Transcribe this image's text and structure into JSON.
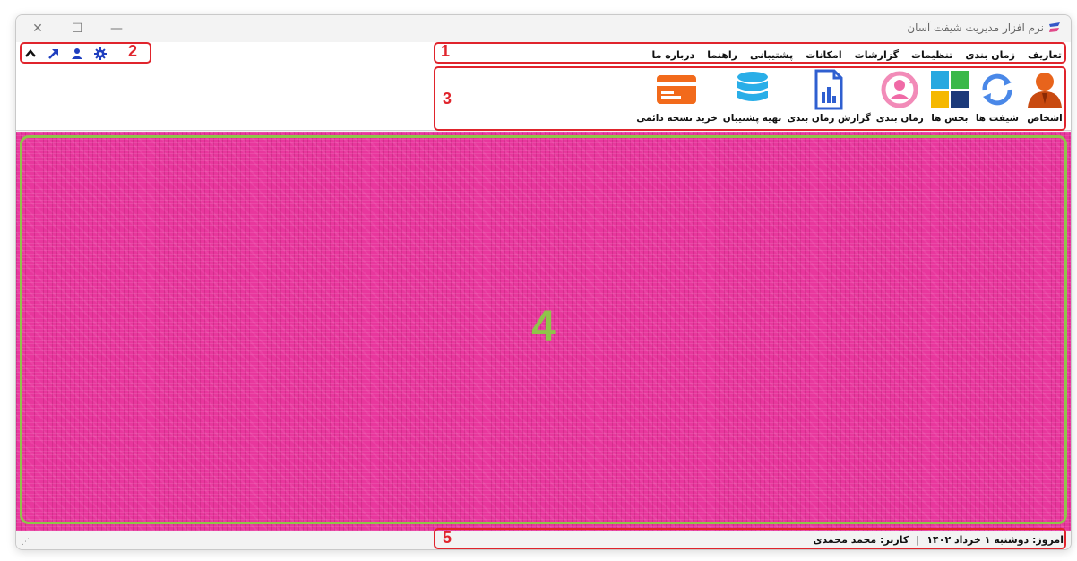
{
  "window": {
    "title": "نرم افزار مدیریت شیفت آسان",
    "controls": {
      "close": "✕",
      "maximize": "☐",
      "minimize": "—"
    }
  },
  "menu": {
    "items": [
      "تعاریف",
      "زمان بندی",
      "تنظیمات",
      "گزارشات",
      "امکانات",
      "پشتیبانی",
      "راهنما",
      "درباره ما"
    ]
  },
  "quick_icons": [
    "gear-icon",
    "user-icon",
    "arrow-up-right-icon",
    "chevron-up-icon"
  ],
  "ribbon": {
    "items": [
      {
        "label": "اشخاص",
        "icon": "person-icon"
      },
      {
        "label": "شیفت ها",
        "icon": "refresh-cycle-icon"
      },
      {
        "label": "بخش ها",
        "icon": "tiles-icon"
      },
      {
        "label": "زمان بندی",
        "icon": "schedule-cycle-icon"
      },
      {
        "label": "گزارش زمان بندی",
        "icon": "report-chart-icon"
      },
      {
        "label": "تهیه پشتیبان",
        "icon": "database-icon"
      },
      {
        "label": "خرید نسخه دائمی",
        "icon": "credit-card-icon"
      }
    ]
  },
  "annotations": {
    "n1": "1",
    "n2": "2",
    "n3": "3",
    "n4": "4",
    "n5": "5"
  },
  "status": {
    "today": "امروز: دوشنبه ۱ خرداد ۱۴۰۲",
    "separator": "|",
    "user": "کاربر: محمد محمدی"
  },
  "colors": {
    "annotation_red": "#e0242c",
    "annotation_green": "#8fc44a",
    "canvas_pink": "#e8379d"
  }
}
